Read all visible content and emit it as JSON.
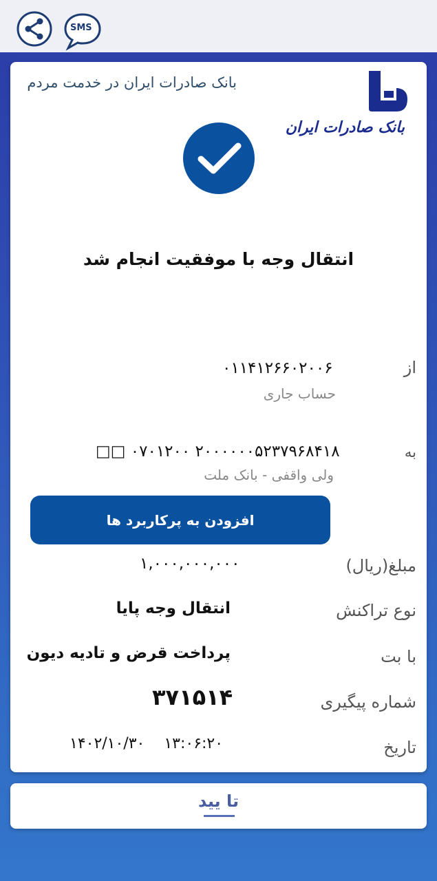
{
  "topbar": {
    "sms_label": "SMS"
  },
  "header": {
    "slogan": "بانک صادرات ایران در خدمت مردم",
    "logo_text": "بانک صادرات ایران"
  },
  "status": {
    "message": "انتقال وجه با  موفقیت انجام شد"
  },
  "from": {
    "label": "از",
    "account": "۰۱۱۴۱۲۶۶۰۲۰۰۶",
    "account_type": "حساب جاری"
  },
  "to": {
    "label": "به",
    "account": "□□ ۰۷۰۱۲۰۰ ۲۰۰۰۰۰۰۵۲۳۷۹۶۸۴۱۸",
    "owner": "ولی واقفی - بانک ملت"
  },
  "add_button": {
    "label": "افزودن به پرکاربرد ها"
  },
  "details": [
    {
      "label": "مبلغ(ریال)",
      "value": "۱,۰۰۰,۰۰۰,۰۰۰"
    },
    {
      "label": "نوع تراکنش",
      "value": "انتقال وجه پایا"
    },
    {
      "label": "با بت",
      "value": "پرداخت قرض و تادیه دیون"
    },
    {
      "label": "شماره پیگیری",
      "value": "۳۷۱۵۱۴"
    },
    {
      "label": "تاریخ",
      "value": "۱۴۰۲/۱۰/۳۰    ۱۳:۰۶:۲۰"
    }
  ],
  "confirm": {
    "label": "تا یید"
  },
  "colors": {
    "primary": "#0a51a0",
    "logo": "#1a2d8f",
    "topbar": "#eef0f6"
  }
}
